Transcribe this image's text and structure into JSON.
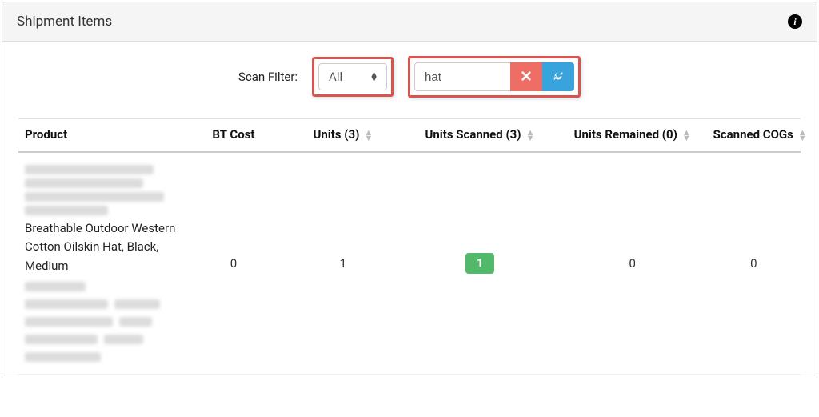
{
  "panel": {
    "title": "Shipment Items"
  },
  "filter": {
    "label": "Scan Filter:",
    "selected": "All",
    "search_value": "hat"
  },
  "columns": {
    "product": "Product",
    "bt_cost": "BT Cost",
    "units": "Units (3)",
    "units_scanned": "Units Scanned (3)",
    "units_remained": "Units Remained (0)",
    "scanned_cogs": "Scanned COGs"
  },
  "row": {
    "product_visible": "Breathable Outdoor Western Cotton Oilskin Hat, Black, Medium",
    "bt_cost": "0",
    "units": "1",
    "units_scanned": "1",
    "units_remained": "0",
    "scanned_cogs": "0"
  }
}
